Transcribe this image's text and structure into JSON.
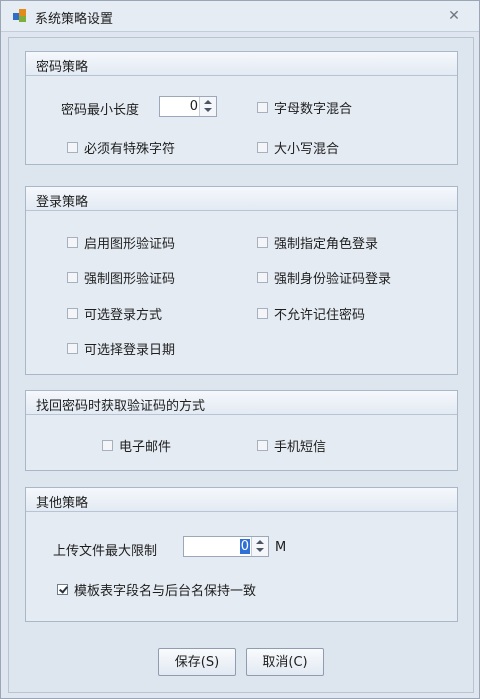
{
  "window": {
    "title": "系统策略设置",
    "close_glyph": "✕"
  },
  "groups": {
    "password_policy": {
      "title": "密码策略",
      "min_length_label": "密码最小长度",
      "min_length_value": "0",
      "checkboxes": {
        "alnum_mix": {
          "label": "字母数字混合",
          "checked": false
        },
        "special_char": {
          "label": "必须有特殊字符",
          "checked": false
        },
        "case_mix": {
          "label": "大小写混合",
          "checked": false
        }
      }
    },
    "login_policy": {
      "title": "登录策略",
      "checkboxes": {
        "enable_captcha": {
          "label": "启用图形验证码",
          "checked": false
        },
        "force_role_login": {
          "label": "强制指定角色登录",
          "checked": false
        },
        "force_captcha": {
          "label": "强制图形验证码",
          "checked": false
        },
        "force_id_code_login": {
          "label": "强制身份验证码登录",
          "checked": false
        },
        "optional_login_method": {
          "label": "可选登录方式",
          "checked": false
        },
        "no_remember_password": {
          "label": "不允许记住密码",
          "checked": false
        },
        "optional_login_date": {
          "label": "可选择登录日期",
          "checked": false
        }
      }
    },
    "recovery_policy": {
      "title": "找回密码时获取验证码的方式",
      "checkboxes": {
        "email": {
          "label": "电子邮件",
          "checked": false
        },
        "sms": {
          "label": "手机短信",
          "checked": false
        }
      }
    },
    "other_policy": {
      "title": "其他策略",
      "upload_limit_label": "上传文件最大限制",
      "upload_limit_value": "0",
      "upload_limit_unit": "M",
      "checkboxes": {
        "template_field_sync": {
          "label": "模板表字段名与后台名保持一致",
          "checked": true
        }
      }
    }
  },
  "buttons": {
    "save": "保存(S)",
    "cancel": "取消(C)"
  }
}
